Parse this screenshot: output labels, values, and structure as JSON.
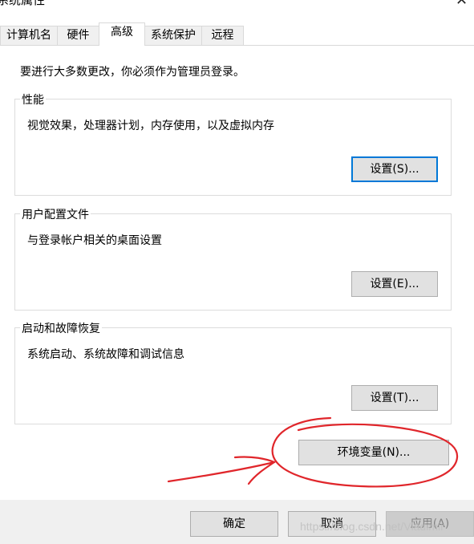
{
  "window": {
    "title": "系统属性",
    "close_glyph": "✕"
  },
  "tabs": [
    {
      "label": "计算机名",
      "active": false
    },
    {
      "label": "硬件",
      "active": false
    },
    {
      "label": "高级",
      "active": true
    },
    {
      "label": "系统保护",
      "active": false
    },
    {
      "label": "远程",
      "active": false
    }
  ],
  "panel": {
    "admin_note": "要进行大多数更改，你必须作为管理员登录。",
    "performance": {
      "title": "性能",
      "description": "视觉效果，处理器计划，内存使用，以及虚拟内存",
      "button": "设置(S)..."
    },
    "user_profiles": {
      "title": "用户配置文件",
      "description": "与登录帐户相关的桌面设置",
      "button": "设置(E)..."
    },
    "startup_recovery": {
      "title": "启动和故障恢复",
      "description": "系统启动、系统故障和调试信息",
      "button": "设置(T)..."
    },
    "env_button": "环境变量(N)..."
  },
  "footer": {
    "ok": "确定",
    "cancel": "取消",
    "apply": "应用(A)"
  },
  "watermark": "https://blog.csdn.net/Vladimir",
  "colors": {
    "accent_border": "#0078d7",
    "annotation_red": "#e0262b",
    "dialog_background": "#f0f0f0"
  }
}
